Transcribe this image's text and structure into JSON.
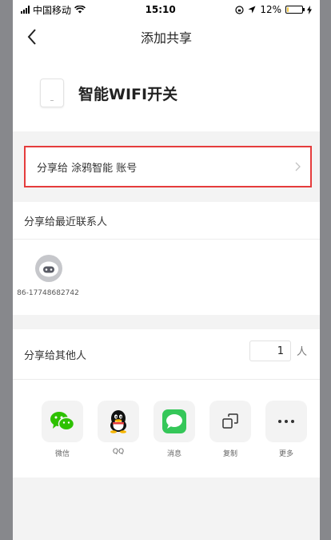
{
  "status": {
    "carrier": "中国移动",
    "time": "15:10",
    "battery_text": "12%",
    "battery_level": 0.12
  },
  "nav": {
    "title": "添加共享"
  },
  "device": {
    "name": "智能WIFI开关"
  },
  "share_account": {
    "label": "分享给 涂鸦智能 账号"
  },
  "recent": {
    "heading": "分享给最近联系人",
    "contacts": [
      {
        "name": "86-17748682742"
      }
    ]
  },
  "others": {
    "label": "分享给其他人",
    "count": "1",
    "unit": "人"
  },
  "share_options": [
    {
      "label": "微信",
      "icon": "wechat-icon"
    },
    {
      "label": "QQ",
      "icon": "qq-icon"
    },
    {
      "label": "消息",
      "icon": "message-icon"
    },
    {
      "label": "复制",
      "icon": "copy-icon"
    },
    {
      "label": "更多",
      "icon": "more-icon"
    }
  ],
  "colors": {
    "highlight_border": "#e53c3c",
    "wechat_green": "#2dc100",
    "message_green": "#35c759"
  }
}
